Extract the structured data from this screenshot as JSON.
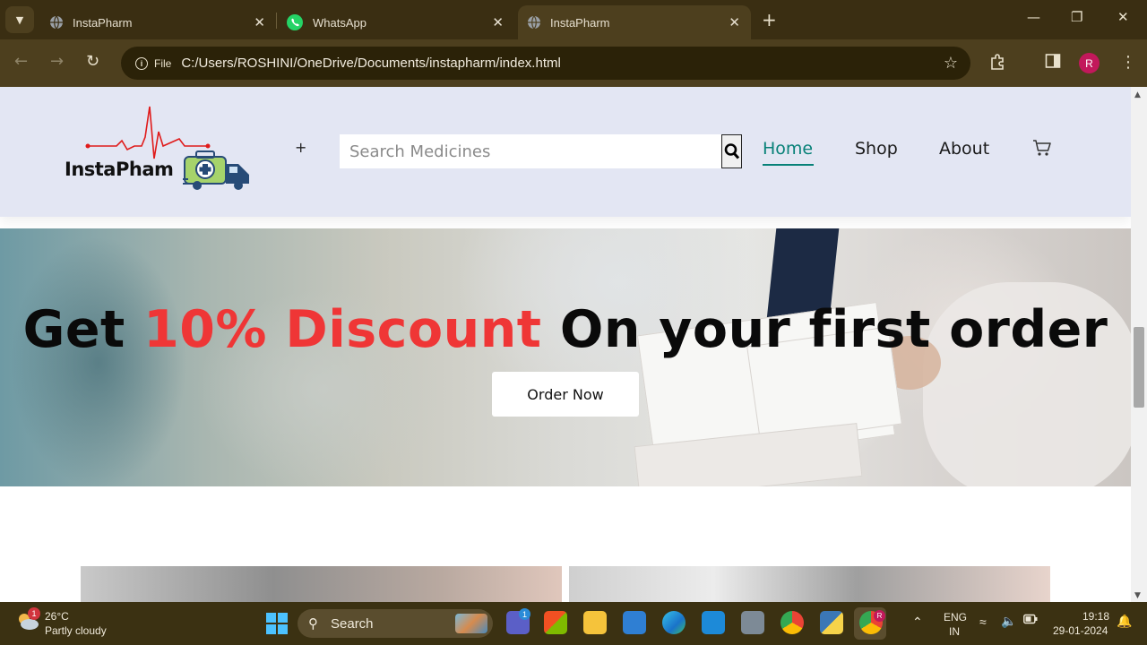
{
  "browser": {
    "tabs": [
      {
        "title": "InstaPharm",
        "active": false
      },
      {
        "title": "WhatsApp",
        "active": false
      },
      {
        "title": "InstaPharm",
        "active": true
      }
    ],
    "site_info_label": "File",
    "url": "C:/Users/ROSHINI/OneDrive/Documents/instapharm/index.html",
    "profile_initial": "R",
    "accent_color": "#c2185b"
  },
  "site": {
    "logo_text": "InstaPham",
    "menu_toggle": "+",
    "search_placeholder": "Search Medicines",
    "nav": [
      {
        "label": "Home",
        "active": true
      },
      {
        "label": "Shop",
        "active": false
      },
      {
        "label": "About",
        "active": false
      }
    ],
    "cart_icon": "cart-icon",
    "colors": {
      "header_bg": "#e3e6f3",
      "nav_active": "#088178",
      "discount_red": "#ef3636"
    }
  },
  "hero": {
    "title_before": "Get ",
    "title_accent": "10% Discount",
    "title_after": " On your first order",
    "button_label": "Order Now"
  },
  "taskbar": {
    "weather_badge": "1",
    "temperature": "26°C",
    "weather_desc": "Partly cloudy",
    "search_label": "Search",
    "teams_badge": "1",
    "language_line1": "ENG",
    "language_line2": "IN",
    "time": "19:18",
    "date": "29-01-2024",
    "chrome_badge": "R"
  }
}
